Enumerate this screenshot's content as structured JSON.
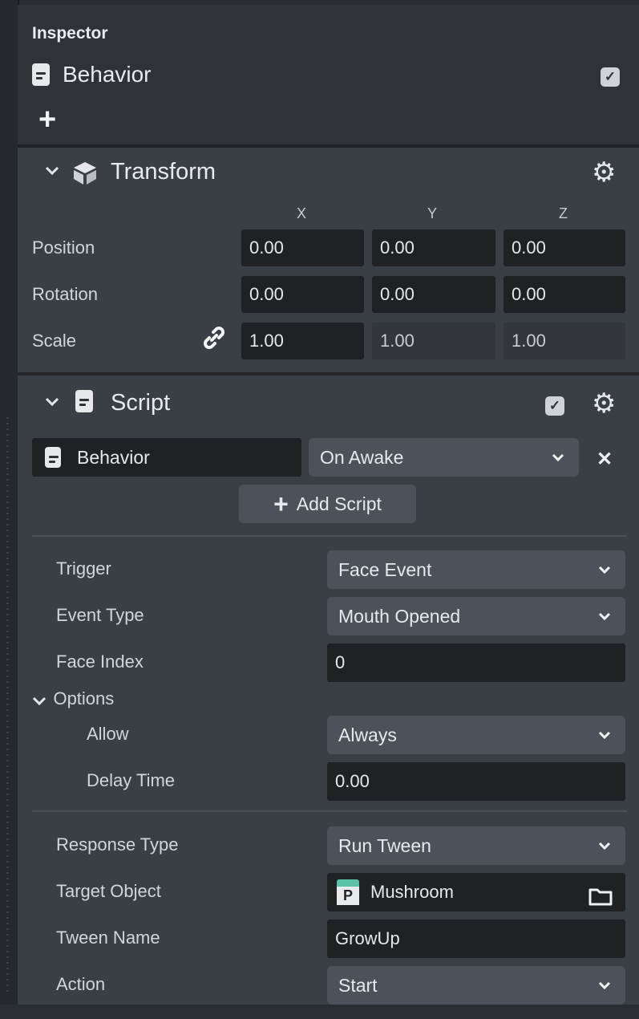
{
  "header": {
    "title": "Inspector",
    "object_name": "Behavior",
    "add_label": "+"
  },
  "transform": {
    "title": "Transform",
    "axes": [
      "X",
      "Y",
      "Z"
    ],
    "rows": [
      {
        "label": "Position",
        "values": [
          "0.00",
          "0.00",
          "0.00"
        ]
      },
      {
        "label": "Rotation",
        "values": [
          "0.00",
          "0.00",
          "0.00"
        ]
      },
      {
        "label": "Scale",
        "values": [
          "1.00",
          "1.00",
          "1.00"
        ]
      }
    ]
  },
  "script": {
    "title": "Script",
    "behavior_label": "Behavior",
    "event": "On Awake",
    "add_script_label": "Add Script",
    "fields": {
      "trigger": {
        "label": "Trigger",
        "value": "Face Event"
      },
      "event_type": {
        "label": "Event Type",
        "value": "Mouth Opened"
      },
      "face_index": {
        "label": "Face Index",
        "value": "0"
      },
      "options": {
        "label": "Options"
      },
      "allow": {
        "label": "Allow",
        "value": "Always"
      },
      "delay_time": {
        "label": "Delay Time",
        "value": "0.00"
      },
      "response_type": {
        "label": "Response Type",
        "value": "Run Tween"
      },
      "target_object": {
        "label": "Target Object",
        "value": "Mushroom",
        "icon_letter": "P"
      },
      "tween_name": {
        "label": "Tween Name",
        "value": "GrowUp"
      },
      "action": {
        "label": "Action",
        "value": "Start"
      }
    }
  },
  "icons": {
    "checkmark": "✓",
    "chevron_down": "⌄",
    "gear": "⚙",
    "close": "✕",
    "link": "🔗"
  },
  "colors": {
    "accent_teal": "#5bc2a8",
    "panel_bg": "#3a3e45",
    "field_bg": "#1f2124"
  }
}
